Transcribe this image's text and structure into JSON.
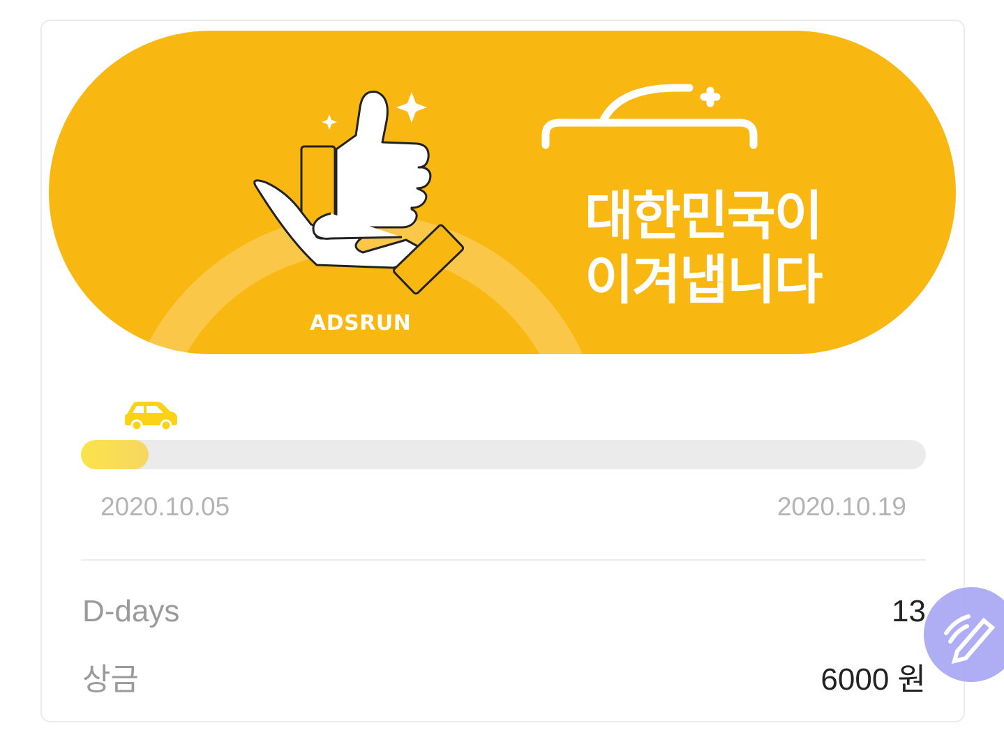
{
  "banner": {
    "title_line1": "대한민국이",
    "title_line2": "이겨냅니다",
    "brand": "ADSRUN",
    "background_color": "#f8b711"
  },
  "progress": {
    "start_date": "2020.10.05",
    "end_date": "2020.10.19",
    "fill_fraction": 0.08,
    "marker_icon": "car-icon",
    "accent_color": "#fbe34a"
  },
  "details": {
    "ddays_label": "D-days",
    "ddays_value": "13",
    "prize_label": "상금",
    "prize_value": "6000 원"
  },
  "fab": {
    "icon": "edit-pencil-icon",
    "color": "#a9a8f5"
  }
}
